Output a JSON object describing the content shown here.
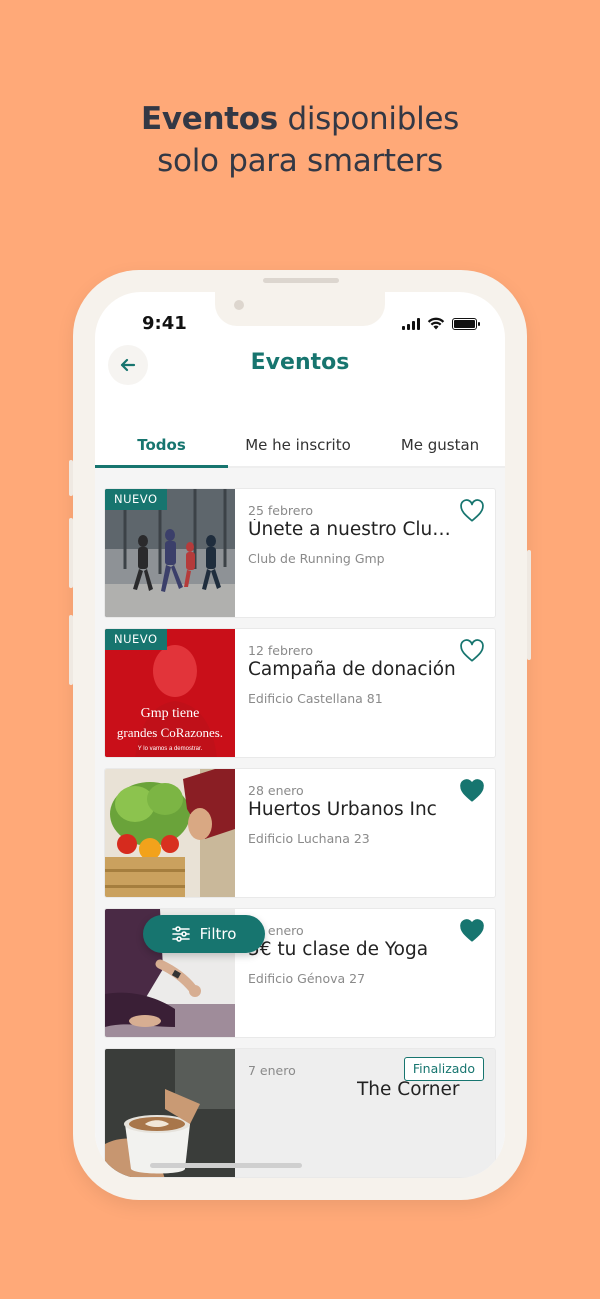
{
  "promo": {
    "title_bold": "Eventos",
    "title_rest": "disponibles",
    "title_line2": "solo para smarters"
  },
  "status_bar": {
    "time": "9:41"
  },
  "header": {
    "title": "Eventos"
  },
  "tabs": [
    {
      "label": "Todos",
      "active": true
    },
    {
      "label": "Me he inscrito",
      "active": false
    },
    {
      "label": "Me gustan",
      "active": false
    }
  ],
  "events": [
    {
      "badge": "NUEVO",
      "date": "25 febrero",
      "title": "Únete a nuestro Club de Running",
      "location": "Club de Running Gmp",
      "liked": false
    },
    {
      "badge": "NUEVO",
      "date": "12 febrero",
      "title": "Campaña de donación",
      "location": "Edificio Castellana 81",
      "liked": false,
      "image_text_1": "Gmp tiene",
      "image_text_2": "grandes CoRazones.",
      "image_text_3": "Y lo vamos a demostrar."
    },
    {
      "date": "28 enero",
      "title": "Huertos Urbanos Inc",
      "location": "Edificio Luchana 23",
      "liked": true
    },
    {
      "date": "26 enero",
      "title": "5€ tu clase de Yoga",
      "location": "Edificio Génova 27",
      "liked": true
    },
    {
      "date": "7 enero",
      "title": "The Corner",
      "status": "Finalizado"
    }
  ],
  "filter_button": {
    "label": "Filtro"
  },
  "colors": {
    "accent": "#17756f",
    "background": "#ffa978"
  },
  "icons": [
    "back-arrow-icon",
    "signal-icon",
    "wifi-icon",
    "battery-icon",
    "heart-outline-icon",
    "heart-filled-icon",
    "filter-icon"
  ]
}
